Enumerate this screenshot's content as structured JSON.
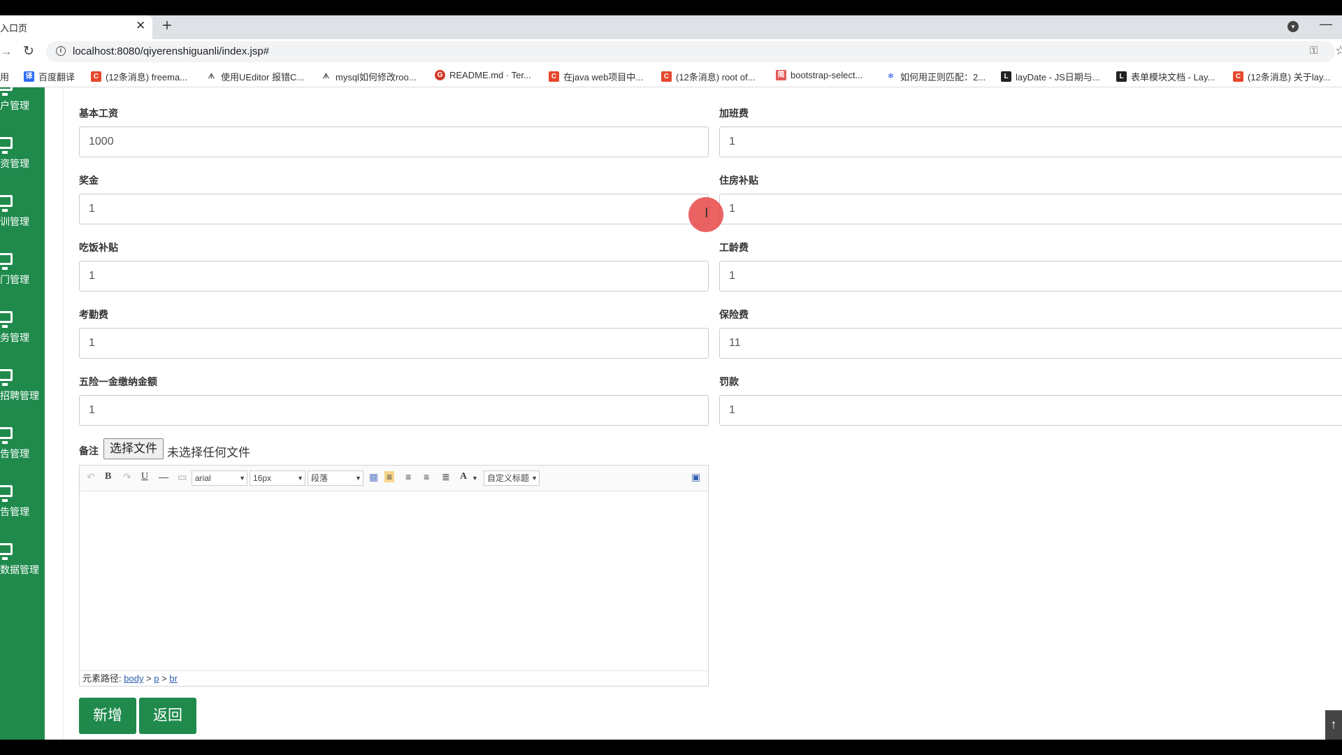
{
  "browser": {
    "tab_title": "入口页",
    "url": "localhost:8080/qiyerenshiguanli/index.jsp#"
  },
  "bookmarks": [
    {
      "label": "用",
      "color": ""
    },
    {
      "label": "百度翻译",
      "color": "#2f6df2"
    },
    {
      "label": "(12条消息) freema...",
      "color": "#e5482d"
    },
    {
      "label": "使用UEditor 报错C...",
      "color": "#555555"
    },
    {
      "label": "mysql如何修改roo...",
      "color": "#555555"
    },
    {
      "label": "README.md · Ter...",
      "color": "#d33a2c"
    },
    {
      "label": "在java web项目中...",
      "color": "#e5482d"
    },
    {
      "label": "(12条消息) root of...",
      "color": "#e5482d"
    },
    {
      "label": "bootstrap-select...",
      "color": "#e25a5a"
    },
    {
      "label": "如何用正则匹配：2...",
      "color": "#2f57e0"
    },
    {
      "label": "layDate - JS日期与...",
      "color": "#222222"
    },
    {
      "label": "表单模块文档 - Lay...",
      "color": "#222222"
    },
    {
      "label": "(12条消息) 关于lay...",
      "color": "#e5482d"
    }
  ],
  "sidebar": {
    "items": [
      "户管理",
      "资管理",
      "训管理",
      "门管理",
      "务管理",
      "招聘管理",
      "告管理",
      "告管理",
      "数据管理"
    ]
  },
  "form": {
    "fields": [
      {
        "label": "基本工资",
        "value": "1000"
      },
      {
        "label": "加班费",
        "value": "1"
      },
      {
        "label": "奖金",
        "value": "1"
      },
      {
        "label": "住房补贴",
        "value": "1"
      },
      {
        "label": "吃饭补贴",
        "value": "1"
      },
      {
        "label": "工龄费",
        "value": "1"
      },
      {
        "label": "考勤费",
        "value": "1"
      },
      {
        "label": "保险费",
        "value": "11"
      },
      {
        "label": "五险一金缴纳金额",
        "value": "1"
      },
      {
        "label": "罚款",
        "value": "1"
      }
    ],
    "remark_label": "备注",
    "file_button": "选择文件",
    "file_status": "未选择任何文件"
  },
  "editor": {
    "font_family": "arial",
    "font_size": "16px",
    "paragraph": "段落",
    "custom_title": "自定义标题",
    "path_label": "元素路径:",
    "path": [
      "body",
      "p",
      "br"
    ]
  },
  "actions": {
    "submit": "新增",
    "back": "返回"
  },
  "colors": {
    "brand_green": "#1f8a4c",
    "cursor_highlight": "#e84646"
  }
}
